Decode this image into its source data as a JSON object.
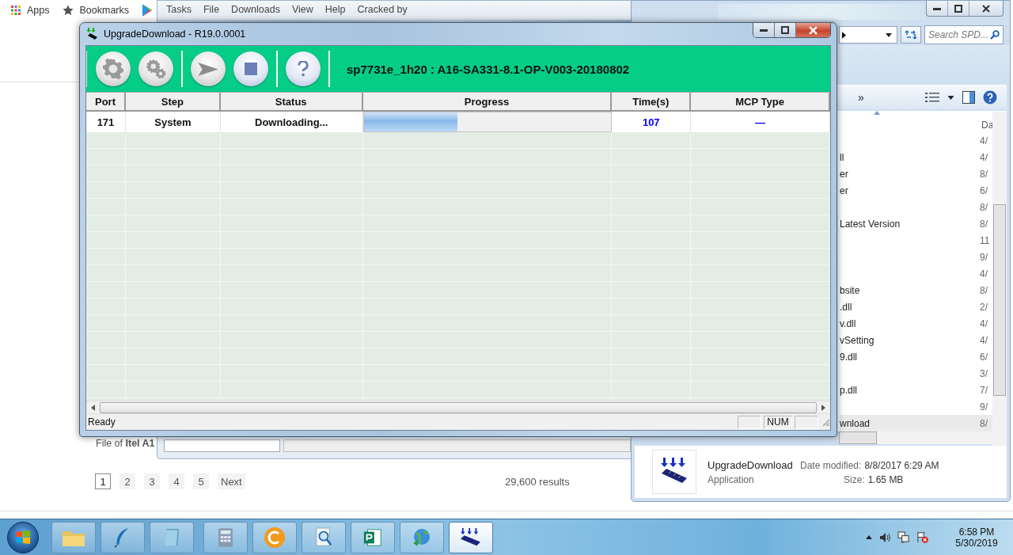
{
  "browser": {
    "bookmarks": [
      {
        "kind": "apps",
        "label": "Apps"
      },
      {
        "kind": "star",
        "label": "Bookmarks"
      },
      {
        "kind": "play"
      }
    ],
    "snippet": "File of **Itel A1**",
    "pages": [
      {
        "label": "1",
        "selected": true
      },
      {
        "label": "2",
        "selected": false
      },
      {
        "label": "3",
        "selected": false
      },
      {
        "label": "4",
        "selected": false
      },
      {
        "label": "5",
        "selected": false
      },
      {
        "label": "Next",
        "selected": false
      }
    ],
    "results": "29,600 results"
  },
  "download_manager": {
    "menu": [
      "Tasks",
      "File",
      "Downloads",
      "View",
      "Help",
      "Cracked by"
    ]
  },
  "explorer": {
    "search": {
      "placeholder": "Search SPD..."
    },
    "toolbar_overflow": "»",
    "column_header": "Da",
    "rows": [
      {
        "date": "4/",
        "selected": false
      },
      {
        "name": "ll",
        "date": "4/",
        "selected": false
      },
      {
        "name": "er",
        "date": "8/",
        "selected": false
      },
      {
        "name": "er",
        "date": "6/",
        "selected": false
      },
      {
        "date": "8/",
        "selected": false
      },
      {
        "name": "Latest Version",
        "date": "8/",
        "selected": false
      },
      {
        "date": "11",
        "selected": false
      },
      {
        "date": "9/",
        "selected": false
      },
      {
        "date": "4/",
        "selected": false
      },
      {
        "name": "bsite",
        "date": "8/",
        "selected": false
      },
      {
        "name": ".dll",
        "date": "2/",
        "selected": false
      },
      {
        "name": "v.dll",
        "date": "4/",
        "selected": false
      },
      {
        "name": "vSetting",
        "date": "4/",
        "selected": false
      },
      {
        "name": "9.dll",
        "date": "6/",
        "selected": false
      },
      {
        "date": "3/",
        "selected": false
      },
      {
        "name": "p.dll",
        "date": "7/",
        "selected": false
      },
      {
        "date": "9/",
        "selected": false
      },
      {
        "name": "wnload",
        "date": "8/",
        "selected": true
      }
    ],
    "details": {
      "name": "UpgradeDownload",
      "type": "Application",
      "modified_label": "Date modified:",
      "modified": "8/8/2017 6:29 AM",
      "size_label": "Size:",
      "size": "1.65 MB"
    }
  },
  "window": {
    "title": "UpgradeDownload - R19.0.0001",
    "toolbar": [
      {
        "kind": "settings"
      },
      {
        "kind": "gears"
      },
      {
        "kind": "start"
      },
      {
        "kind": "stop"
      },
      {
        "kind": "help"
      }
    ],
    "firmware": "sp7731e_1h20 : A16-SA331-8.1-OP-V003-20180802",
    "table": {
      "columns": [
        "Port",
        "Step",
        "Status",
        "Progress",
        "Time(s)",
        "MCP Type"
      ],
      "rows": [
        {
          "port": "171",
          "step": "System",
          "status": "Downloading...",
          "level": 0.38,
          "time": "107",
          "mcp_type": "—"
        }
      ]
    },
    "status_bar": {
      "text": "Ready",
      "indicator": "NUM"
    }
  },
  "taskbar": {
    "apps": [
      {
        "kind": "folder",
        "selected": false
      },
      {
        "kind": "feather",
        "selected": false
      },
      {
        "kind": "notepad",
        "selected": false
      },
      {
        "kind": "calculator",
        "selected": false
      },
      {
        "kind": "ccleaner",
        "selected": false
      },
      {
        "kind": "magnifier",
        "selected": false
      },
      {
        "kind": "publisher",
        "selected": false
      },
      {
        "kind": "globe",
        "selected": false
      },
      {
        "kind": "flash",
        "selected": true
      }
    ],
    "time": "6:58 PM",
    "date": "5/30/2019"
  }
}
